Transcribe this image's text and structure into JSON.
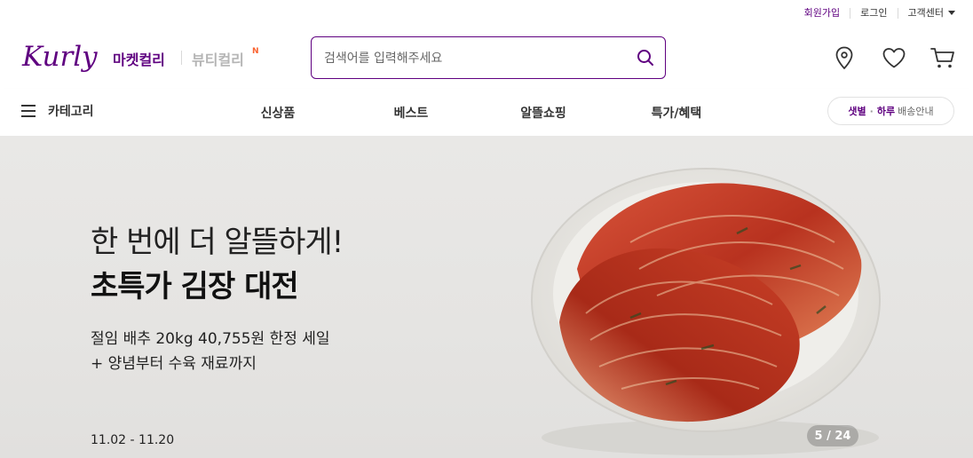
{
  "util": {
    "signup": "회원가입",
    "login": "로그인",
    "customer_center": "고객센터"
  },
  "header": {
    "logo_text": "Kurly",
    "market_label": "마켓컬리",
    "beauty_label": "뷰티컬리",
    "beauty_badge": "N",
    "search_placeholder": "검색어를 입력해주세요",
    "icons": [
      "location-pin-icon",
      "heart-icon",
      "cart-icon"
    ],
    "brand_color": "#5f0080"
  },
  "nav": {
    "category_label": "카테고리",
    "items": [
      "신상품",
      "베스트",
      "알뜰쇼핑",
      "특가/혜택"
    ],
    "delivery": {
      "dawn": "샛별",
      "dot": "·",
      "day": "하루",
      "info": "배송안내"
    }
  },
  "banner": {
    "line1": "한 번에 더 알뜰하게!",
    "line2": "초특가 김장 대전",
    "sub1": "절임 배추 20kg  40,755원 한정 세일",
    "sub2": "+ 양념부터 수육 재료까지",
    "date": "11.02 - 11.20",
    "pager": "5 / 24"
  }
}
